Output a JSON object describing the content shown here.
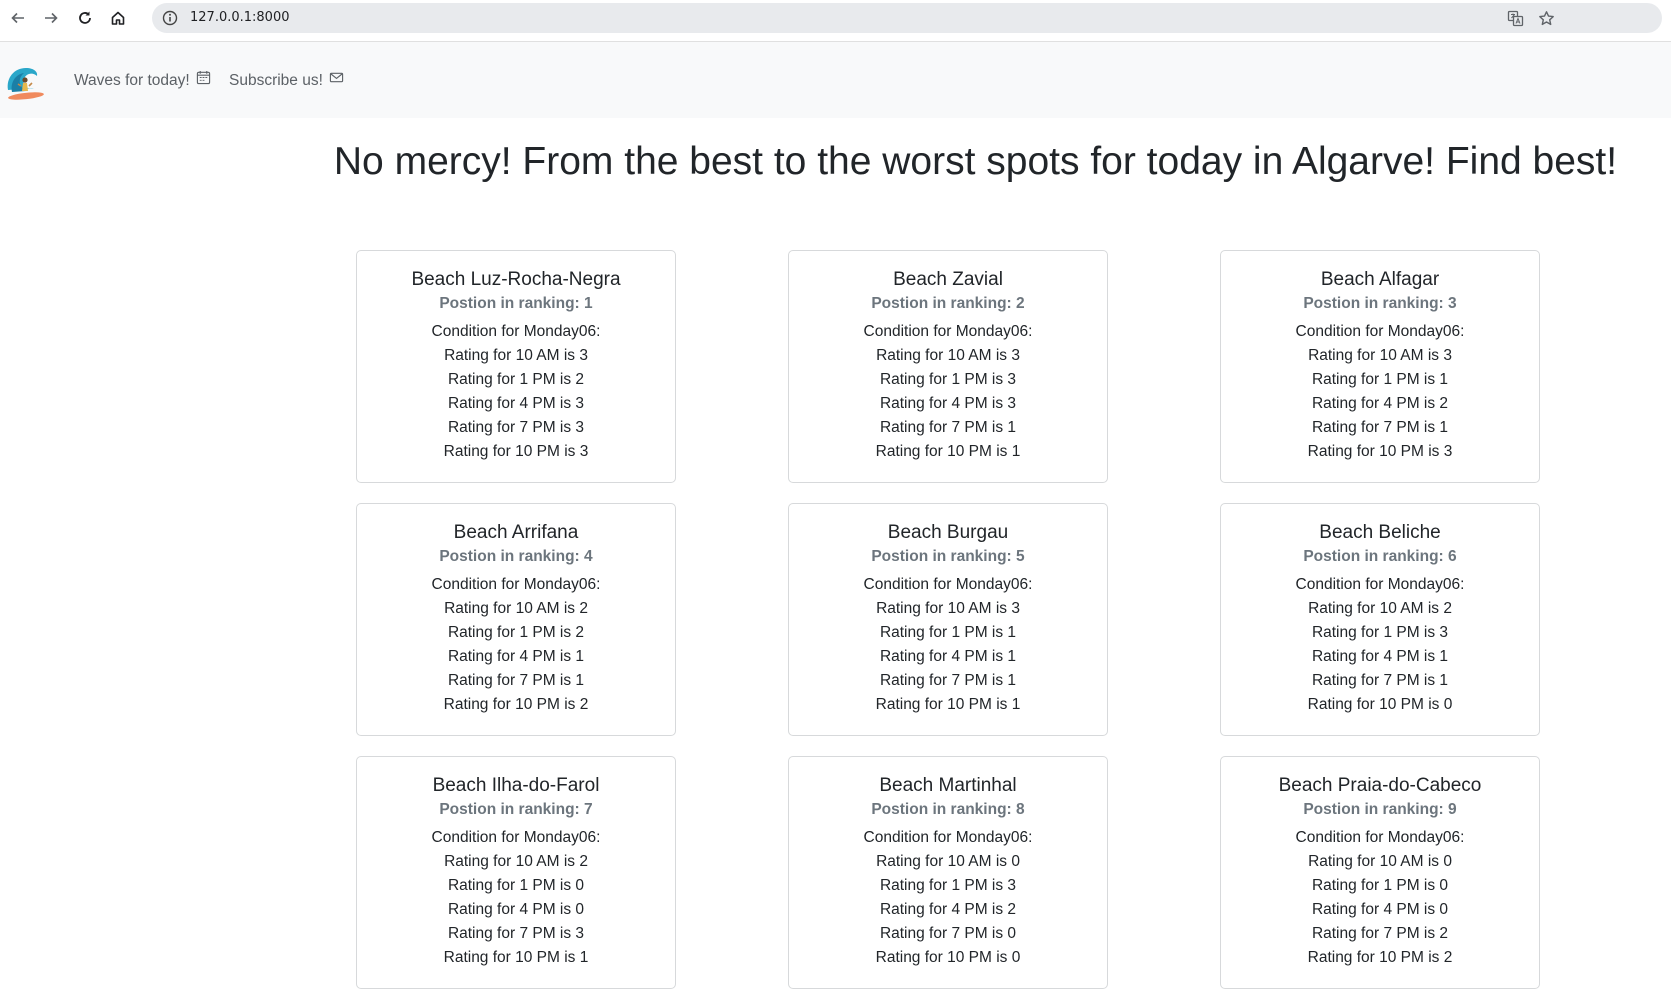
{
  "browser": {
    "url": "127.0.0.1:8000"
  },
  "navbar": {
    "links": [
      {
        "label": "Waves for today!",
        "icon": "calendar-icon"
      },
      {
        "label": "Subscribe us!",
        "icon": "envelope-icon"
      }
    ]
  },
  "page": {
    "title": "No mercy! From the best to the worst spots for today in Algarve! Find best!"
  },
  "beaches": [
    {
      "name": "Beach Luz-Rocha-Negra",
      "position": "Postion in ranking: 1",
      "condition": "Condition for Monday06:",
      "ratings": [
        "Rating for 10 AM is 3",
        "Rating for 1 PM is 2",
        "Rating for 4 PM is 3",
        "Rating for 7 PM is 3",
        "Rating for 10 PM is 3"
      ]
    },
    {
      "name": "Beach Zavial",
      "position": "Postion in ranking: 2",
      "condition": "Condition for Monday06:",
      "ratings": [
        "Rating for 10 AM is 3",
        "Rating for 1 PM is 3",
        "Rating for 4 PM is 3",
        "Rating for 7 PM is 1",
        "Rating for 10 PM is 1"
      ]
    },
    {
      "name": "Beach Alfagar",
      "position": "Postion in ranking: 3",
      "condition": "Condition for Monday06:",
      "ratings": [
        "Rating for 10 AM is 3",
        "Rating for 1 PM is 1",
        "Rating for 4 PM is 2",
        "Rating for 7 PM is 1",
        "Rating for 10 PM is 3"
      ]
    },
    {
      "name": "Beach Arrifana",
      "position": "Postion in ranking: 4",
      "condition": "Condition for Monday06:",
      "ratings": [
        "Rating for 10 AM is 2",
        "Rating for 1 PM is 2",
        "Rating for 4 PM is 1",
        "Rating for 7 PM is 1",
        "Rating for 10 PM is 2"
      ]
    },
    {
      "name": "Beach Burgau",
      "position": "Postion in ranking: 5",
      "condition": "Condition for Monday06:",
      "ratings": [
        "Rating for 10 AM is 3",
        "Rating for 1 PM is 1",
        "Rating for 4 PM is 1",
        "Rating for 7 PM is 1",
        "Rating for 10 PM is 1"
      ]
    },
    {
      "name": "Beach Beliche",
      "position": "Postion in ranking: 6",
      "condition": "Condition for Monday06:",
      "ratings": [
        "Rating for 10 AM is 2",
        "Rating for 1 PM is 3",
        "Rating for 4 PM is 1",
        "Rating for 7 PM is 1",
        "Rating for 10 PM is 0"
      ]
    },
    {
      "name": "Beach Ilha-do-Farol",
      "position": "Postion in ranking: 7",
      "condition": "Condition for Monday06:",
      "ratings": [
        "Rating for 10 AM is 2",
        "Rating for 1 PM is 0",
        "Rating for 4 PM is 0",
        "Rating for 7 PM is 3",
        "Rating for 10 PM is 1"
      ]
    },
    {
      "name": "Beach Martinhal",
      "position": "Postion in ranking: 8",
      "condition": "Condition for Monday06:",
      "ratings": [
        "Rating for 10 AM is 0",
        "Rating for 1 PM is 3",
        "Rating for 4 PM is 2",
        "Rating for 7 PM is 0",
        "Rating for 10 PM is 0"
      ]
    },
    {
      "name": "Beach Praia-do-Cabeco",
      "position": "Postion in ranking: 9",
      "condition": "Condition for Monday06:",
      "ratings": [
        "Rating for 10 AM is 0",
        "Rating for 1 PM is 0",
        "Rating for 4 PM is 0",
        "Rating for 7 PM is 2",
        "Rating for 10 PM is 2"
      ]
    }
  ]
}
